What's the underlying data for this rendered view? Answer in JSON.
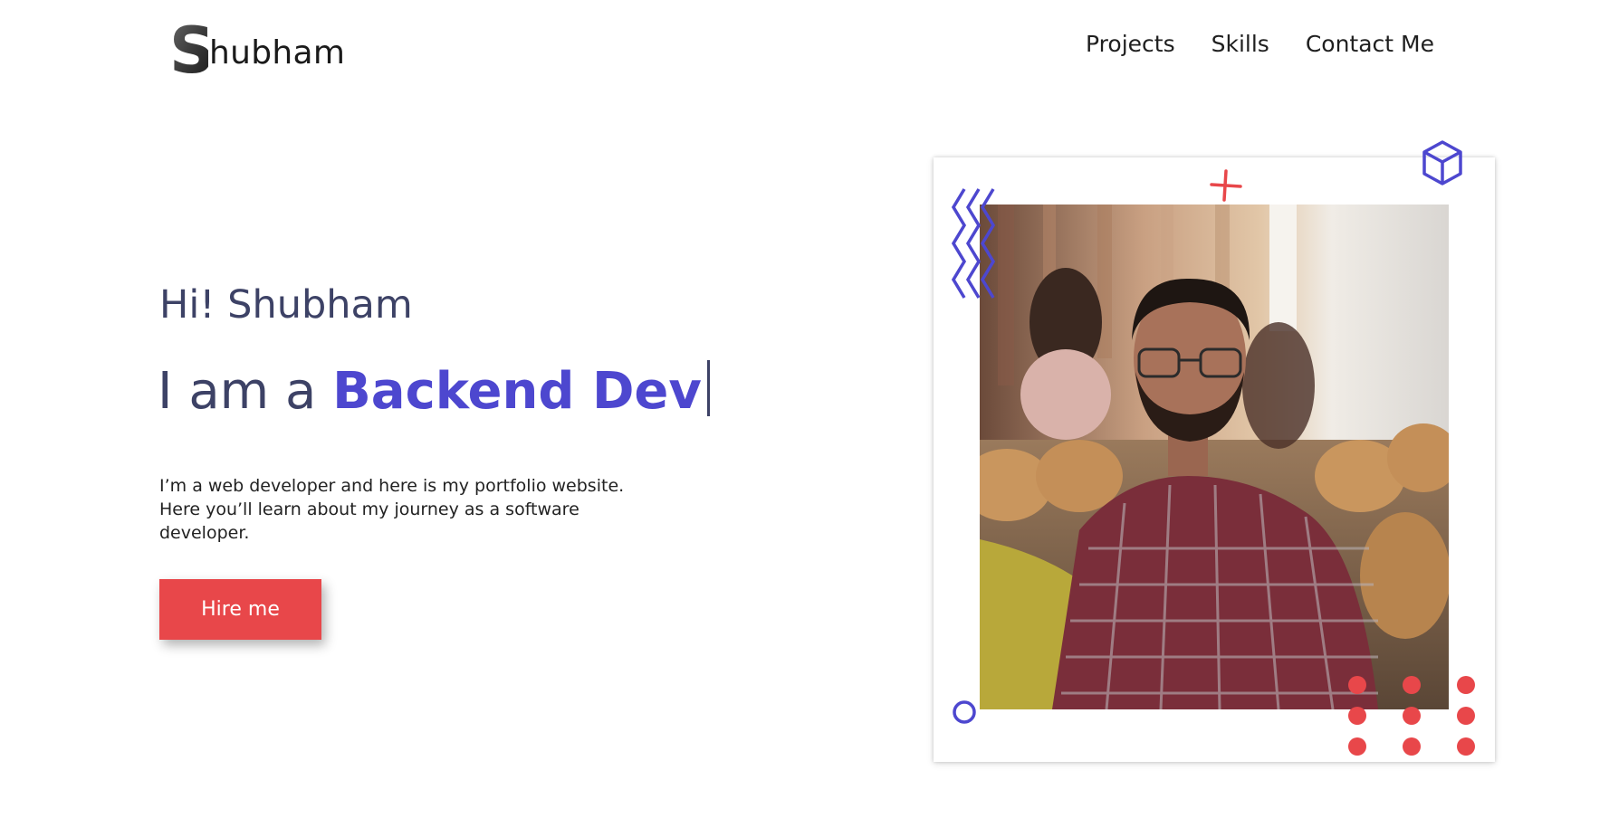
{
  "header": {
    "logo_letter": "S",
    "logo_text": "hubham",
    "nav": [
      {
        "label": "Projects"
      },
      {
        "label": "Skills"
      },
      {
        "label": "Contact Me"
      }
    ]
  },
  "hero": {
    "greeting": "Hi! Shubham",
    "headline_prefix": "I am a ",
    "headline_role": "Backend Dev",
    "intro": "I’m a web developer and here is my portfolio website. Here you’ll learn about my journey as a software developer.",
    "cta_label": "Hire me"
  },
  "colors": {
    "accent_purple": "#4d47cf",
    "accent_red": "#e8474a",
    "heading_text": "#3d4266"
  },
  "icons": {
    "zigzag": "zigzag-icon",
    "plus": "plus-icon",
    "cube": "cube-icon",
    "ring": "ring-icon",
    "dots": "dot-grid-icon"
  }
}
